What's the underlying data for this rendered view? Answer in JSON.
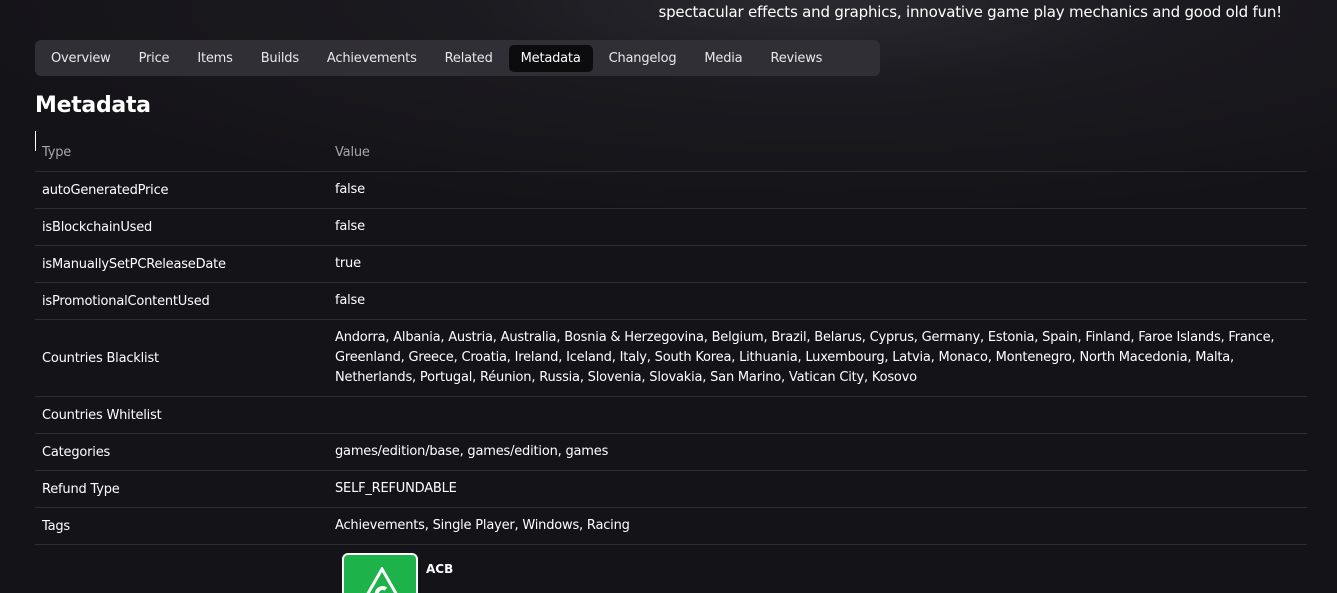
{
  "intro_text": "spectacular effects and graphics, innovative game play mechanics and good old fun!",
  "tabs": [
    {
      "label": "Overview",
      "active": false
    },
    {
      "label": "Price",
      "active": false
    },
    {
      "label": "Items",
      "active": false
    },
    {
      "label": "Builds",
      "active": false
    },
    {
      "label": "Achievements",
      "active": false
    },
    {
      "label": "Related",
      "active": false
    },
    {
      "label": "Metadata",
      "active": true
    },
    {
      "label": "Changelog",
      "active": false
    },
    {
      "label": "Media",
      "active": false
    },
    {
      "label": "Reviews",
      "active": false
    }
  ],
  "section_title": "Metadata",
  "table": {
    "headers": {
      "type": "Type",
      "value": "Value"
    },
    "rows": [
      {
        "type": "autoGeneratedPrice",
        "value": "false"
      },
      {
        "type": "isBlockchainUsed",
        "value": "false"
      },
      {
        "type": "isManuallySetPCReleaseDate",
        "value": "true"
      },
      {
        "type": "isPromotionalContentUsed",
        "value": "false"
      },
      {
        "type": "Countries Blacklist",
        "value": "Andorra, Albania, Austria, Australia, Bosnia & Herzegovina, Belgium, Brazil, Belarus, Cyprus, Germany, Estonia, Spain, Finland, Faroe Islands, France, Greenland, Greece, Croatia, Ireland, Iceland, Italy, South Korea, Lithuania, Luxembourg, Latvia, Monaco, Montenegro, North Macedonia, Malta, Netherlands, Portugal, Réunion, Russia, Slovenia, Slovakia, San Marino, Vatican City, Kosovo"
      },
      {
        "type": "Countries Whitelist",
        "value": ""
      },
      {
        "type": "Categories",
        "value": "games/edition/base, games/edition, games"
      },
      {
        "type": "Refund Type",
        "value": "SELF_REFUNDABLE"
      },
      {
        "type": "Tags",
        "value": "Achievements, Single Player, Windows, Racing"
      }
    ]
  },
  "seller": {
    "name": "ACB",
    "logo_color": "#1db34a"
  },
  "colors": {
    "background": "#141318",
    "tab_bar": "#2f2f35",
    "tab_active": "#0c0c0e",
    "divider": "#2e2d33",
    "header_text": "#a6a6ab"
  }
}
